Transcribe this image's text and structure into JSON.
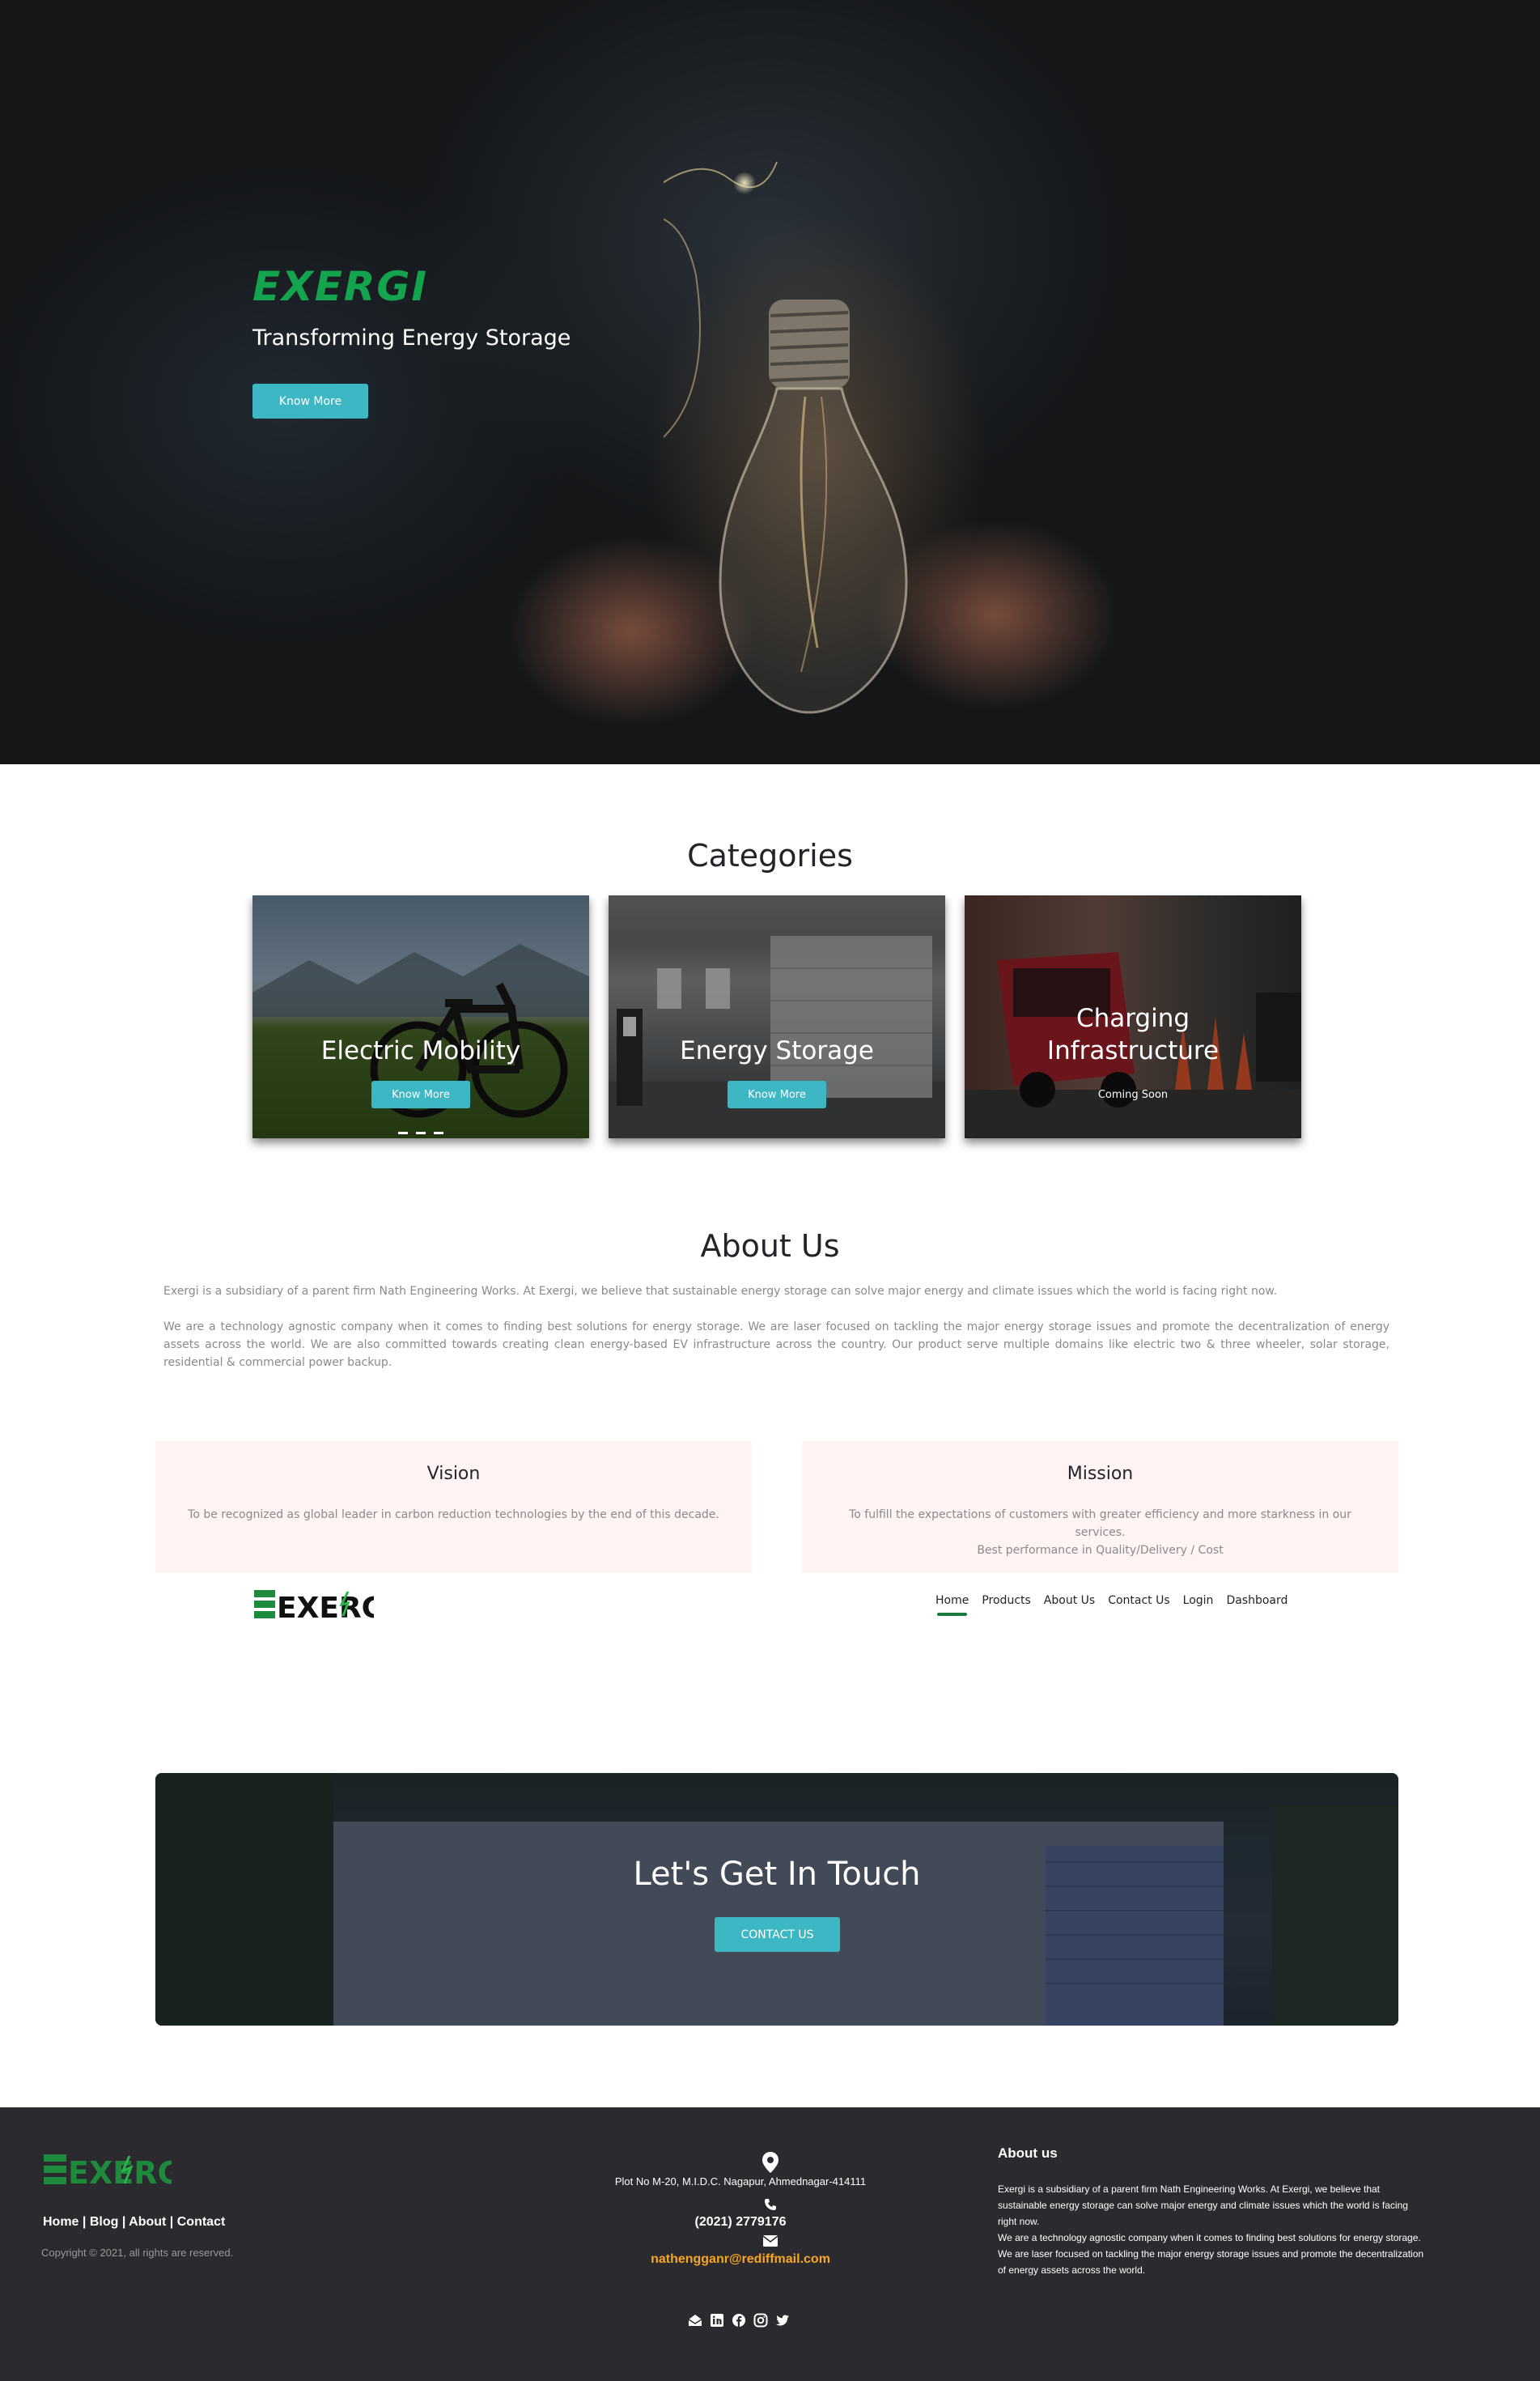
{
  "hero": {
    "brand": "EXERGI",
    "tagline": "Transforming Energy Storage",
    "button_label": "Know More"
  },
  "categories": {
    "title": "Categories",
    "items": [
      {
        "label": "Electric Mobility",
        "button_label": "Know More"
      },
      {
        "label": "Energy Storage",
        "button_label": "Know More"
      },
      {
        "label_line1": "Charging",
        "label_line2": "Infrastructure",
        "status": "Coming Soon"
      }
    ]
  },
  "about": {
    "title": "About Us",
    "paragraph1": "Exergi is a subsidiary of a parent firm Nath Engineering Works. At Exergi, we believe that sustainable energy storage can solve major energy and climate issues which the world is facing right now.",
    "paragraph2": "We are a technology agnostic company when it comes to finding best solutions for energy storage. We are laser focused on tackling the major energy storage issues and promote the decentralization of energy assets across the world. We are also committed towards creating clean energy-based EV infrastructure across the country. Our product serve multiple domains like electric two & three wheeler, solar storage, residential & commercial power backup."
  },
  "vision": {
    "title": "Vision",
    "text": "To be recognized as global leader in carbon reduction technologies by the end of this decade."
  },
  "mission": {
    "title": "Mission",
    "text": "To fulfill the expectations of customers with greater efficiency and more starkness in our services.",
    "text2": "Best performance in Quality/Delivery / Cost"
  },
  "navbar": {
    "logo_text": "EXERGI",
    "items": [
      "Home",
      "Products",
      "About Us",
      "Contact Us",
      "Login",
      "Dashboard"
    ],
    "active": "Home"
  },
  "contact": {
    "title": "Let's Get In Touch",
    "button_label": "CONTACT US"
  },
  "footer": {
    "logo_text": "EXERGI",
    "links": [
      "Home",
      "Blog",
      "About",
      "Contact"
    ],
    "copyright": "Copyright © 2021, all rights are reserved.",
    "address": "Plot No M-20, M.I.D.C. Nagapur, Ahmednagar-414111",
    "phone": "(2021) 2779176",
    "email": "nathengganr@rediffmail.com",
    "about_title": "About us",
    "about_text1": "Exergi is a subsidiary of a parent firm Nath Engineering Works. At Exergi, we believe that sustainable energy storage can solve major energy and climate issues which the world is facing right now.",
    "about_text2": "We are a technology agnostic company when it comes to finding best solutions for energy storage. We are laser focused on tackling the major energy storage issues and promote the decentralization of energy assets across the world.",
    "social_icons": [
      "email-icon",
      "linkedin-icon",
      "facebook-icon",
      "instagram-icon",
      "twitter-icon"
    ]
  },
  "colors": {
    "brand_green": "#14a44d",
    "accent_teal": "#3db7c4",
    "footer_bg": "#2b2a2f",
    "email_orange": "#f5a623",
    "vm_bg": "#fff3f3"
  }
}
